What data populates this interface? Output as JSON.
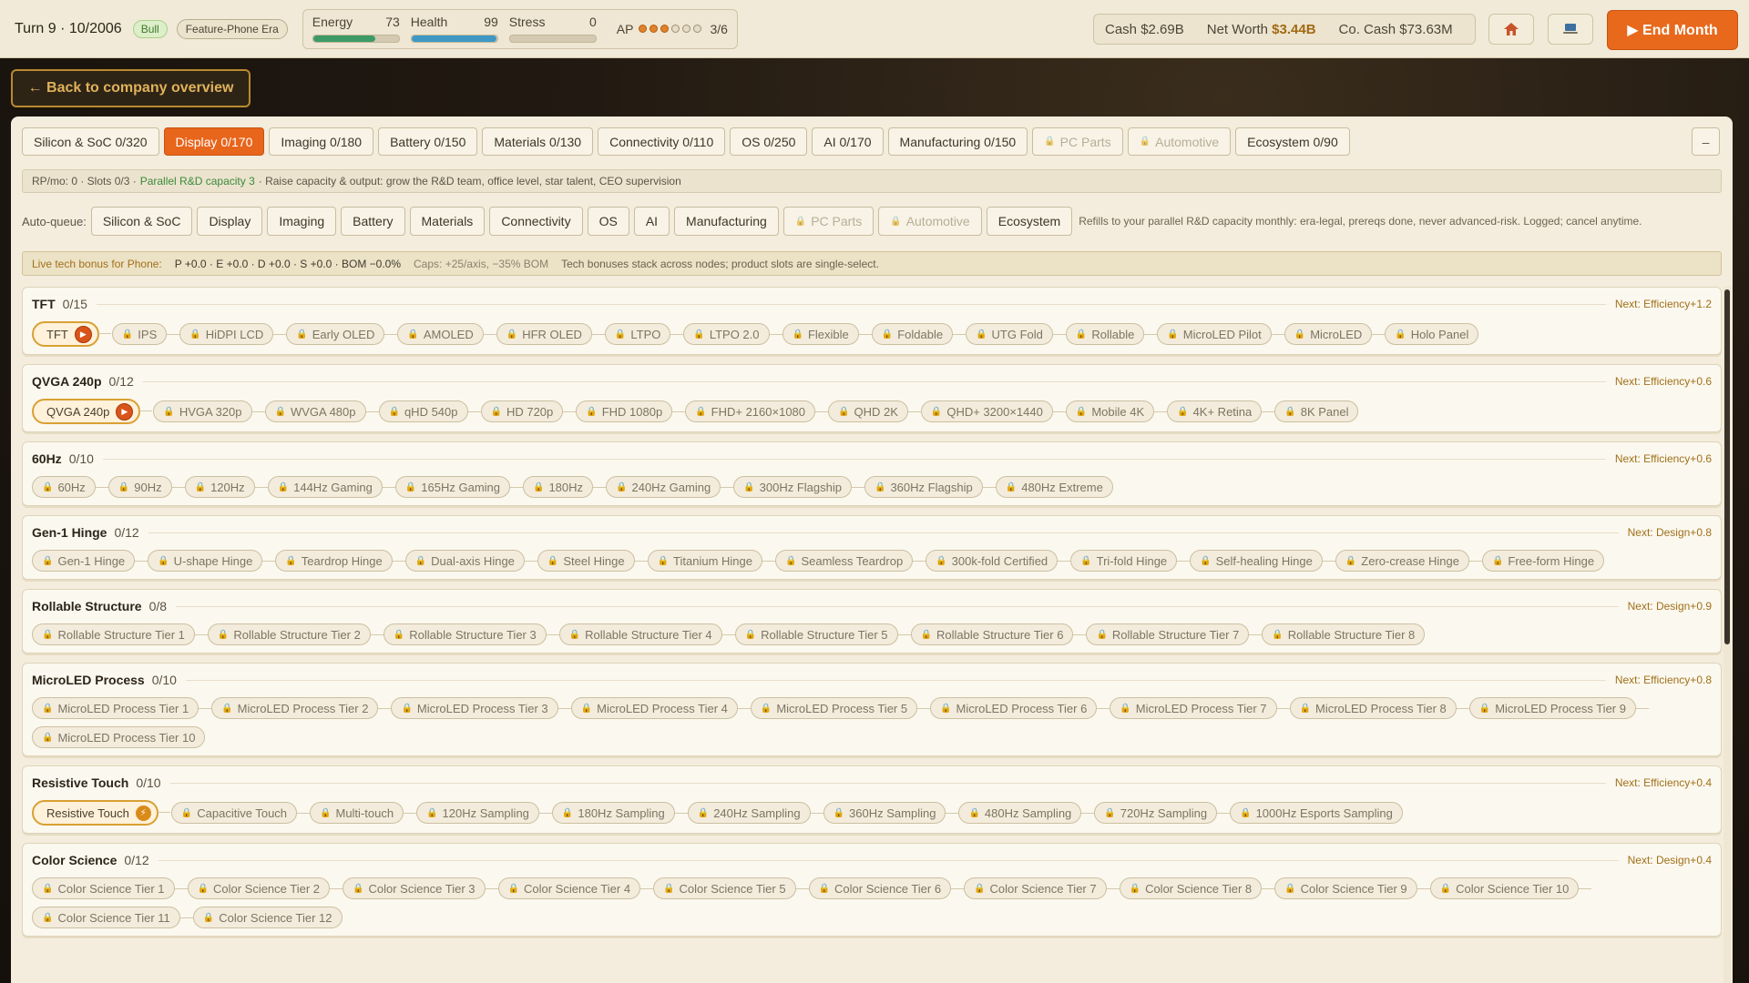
{
  "topbar": {
    "turn": "Turn 9 · 10/2006",
    "market": "Bull",
    "era": "Feature-Phone Era",
    "stats": [
      {
        "label": "Energy",
        "value": "73",
        "fill": 0.73,
        "color": "#3d9a67"
      },
      {
        "label": "Health",
        "value": "99",
        "fill": 0.99,
        "color": "#3f98c4"
      },
      {
        "label": "Stress",
        "value": "0",
        "fill": 0.0,
        "color": "#8f8775"
      }
    ],
    "ap": {
      "label": "AP",
      "value": "3/6",
      "used": 3,
      "total": 6
    },
    "money": {
      "cash_label": "Cash",
      "cash": "$2.69B",
      "networth_label": "Net Worth",
      "networth": "$3.44B",
      "cocash_label": "Co. Cash",
      "cocash": "$73.63M"
    },
    "home_icon": "home-icon",
    "device_icon": "laptop-icon",
    "end_month": "▶ End Month"
  },
  "back_label": "← Back to company overview",
  "tabs": [
    {
      "label": "Silicon & SoC 0/320",
      "state": "normal"
    },
    {
      "label": "Display 0/170",
      "state": "active"
    },
    {
      "label": "Imaging 0/180",
      "state": "normal"
    },
    {
      "label": "Battery 0/150",
      "state": "normal"
    },
    {
      "label": "Materials 0/130",
      "state": "normal"
    },
    {
      "label": "Connectivity 0/110",
      "state": "normal"
    },
    {
      "label": "OS 0/250",
      "state": "normal"
    },
    {
      "label": "AI 0/170",
      "state": "normal"
    },
    {
      "label": "Manufacturing 0/150",
      "state": "normal"
    },
    {
      "label": "PC Parts",
      "state": "locked"
    },
    {
      "label": "Automotive",
      "state": "locked"
    },
    {
      "label": "Ecosystem 0/90",
      "state": "normal"
    }
  ],
  "collapse_label": "–",
  "info": {
    "prefix": "RP/mo: 0 · Slots 0/3 ·",
    "capacity": "Parallel R&D capacity 3",
    "suffix": "· Raise capacity & output: grow the R&D team, office level, star talent, CEO supervision"
  },
  "autoqueue": {
    "label": "Auto-queue:",
    "items": [
      {
        "label": "Silicon & SoC",
        "locked": false
      },
      {
        "label": "Display",
        "locked": false
      },
      {
        "label": "Imaging",
        "locked": false
      },
      {
        "label": "Battery",
        "locked": false
      },
      {
        "label": "Materials",
        "locked": false
      },
      {
        "label": "Connectivity",
        "locked": false
      },
      {
        "label": "OS",
        "locked": false
      },
      {
        "label": "AI",
        "locked": false
      },
      {
        "label": "Manufacturing",
        "locked": false
      },
      {
        "label": "PC Parts",
        "locked": true
      },
      {
        "label": "Automotive",
        "locked": true
      },
      {
        "label": "Ecosystem",
        "locked": false
      }
    ],
    "note": "Refills to your parallel R&D capacity monthly: era-legal, prereqs done, never advanced-risk. Logged; cancel anytime."
  },
  "bonus": {
    "label": "Live tech bonus for Phone:",
    "values": "P +0.0 · E +0.0 · D +0.0 · S +0.0 · BOM −0.0%",
    "caps": "Caps: +25/axis, −35% BOM",
    "note": "Tech bonuses stack across nodes; product slots are single-select."
  },
  "rows": [
    {
      "title": "TFT",
      "count": "0/15",
      "next": "Next: Efficiency+1.2",
      "active": "TFT",
      "badge": "play",
      "nodes": [
        "IPS",
        "HiDPI LCD",
        "Early OLED",
        "AMOLED",
        "HFR OLED",
        "LTPO",
        "LTPO 2.0",
        "Flexible",
        "Foldable",
        "UTG Fold",
        "Rollable",
        "MicroLED Pilot",
        "MicroLED",
        "Holo Panel"
      ]
    },
    {
      "title": "QVGA 240p",
      "count": "0/12",
      "next": "Next: Efficiency+0.6",
      "active": "QVGA 240p",
      "badge": "play",
      "nodes": [
        "HVGA 320p",
        "WVGA 480p",
        "qHD 540p",
        "HD 720p",
        "FHD 1080p",
        "FHD+ 2160×1080",
        "QHD 2K",
        "QHD+ 3200×1440",
        "Mobile 4K",
        "4K+ Retina",
        "8K Panel"
      ]
    },
    {
      "title": "60Hz",
      "count": "0/10",
      "next": "Next: Efficiency+0.6",
      "active": null,
      "badge": null,
      "nodes": [
        "60Hz",
        "90Hz",
        "120Hz",
        "144Hz Gaming",
        "165Hz Gaming",
        "180Hz",
        "240Hz Gaming",
        "300Hz Flagship",
        "360Hz Flagship",
        "480Hz Extreme"
      ]
    },
    {
      "title": "Gen-1 Hinge",
      "count": "0/12",
      "next": "Next: Design+0.8",
      "active": null,
      "badge": null,
      "nodes": [
        "Gen-1 Hinge",
        "U-shape Hinge",
        "Teardrop Hinge",
        "Dual-axis Hinge",
        "Steel Hinge",
        "Titanium Hinge",
        "Seamless Teardrop",
        "300k-fold Certified",
        "Tri-fold Hinge",
        "Self-healing Hinge",
        "Zero-crease Hinge",
        "Free-form Hinge"
      ]
    },
    {
      "title": "Rollable Structure",
      "count": "0/8",
      "next": "Next: Design+0.9",
      "active": null,
      "badge": null,
      "nodes": [
        "Rollable Structure Tier 1",
        "Rollable Structure Tier 2",
        "Rollable Structure Tier 3",
        "Rollable Structure Tier 4",
        "Rollable Structure Tier 5",
        "Rollable Structure Tier 6",
        "Rollable Structure Tier 7",
        "Rollable Structure Tier 8"
      ]
    },
    {
      "title": "MicroLED Process",
      "count": "0/10",
      "next": "Next: Efficiency+0.8",
      "active": null,
      "badge": null,
      "nodes": [
        "MicroLED Process Tier 1",
        "MicroLED Process Tier 2",
        "MicroLED Process Tier 3",
        "MicroLED Process Tier 4",
        "MicroLED Process Tier 5",
        "MicroLED Process Tier 6",
        "MicroLED Process Tier 7",
        "MicroLED Process Tier 8",
        "MicroLED Process Tier 9",
        "MicroLED Process Tier 10"
      ]
    },
    {
      "title": "Resistive Touch",
      "count": "0/10",
      "next": "Next: Efficiency+0.4",
      "active": "Resistive Touch",
      "badge": "bolt",
      "nodes": [
        "Capacitive Touch",
        "Multi-touch",
        "120Hz Sampling",
        "180Hz Sampling",
        "240Hz Sampling",
        "360Hz Sampling",
        "480Hz Sampling",
        "720Hz Sampling",
        "1000Hz Esports Sampling"
      ]
    },
    {
      "title": "Color Science",
      "count": "0/12",
      "next": "Next: Design+0.4",
      "active": null,
      "badge": null,
      "nodes": [
        "Color Science Tier 1",
        "Color Science Tier 2",
        "Color Science Tier 3",
        "Color Science Tier 4",
        "Color Science Tier 5",
        "Color Science Tier 6",
        "Color Science Tier 7",
        "Color Science Tier 8",
        "Color Science Tier 9",
        "Color Science Tier 10",
        "Color Science Tier 11",
        "Color Science Tier 12"
      ]
    }
  ]
}
